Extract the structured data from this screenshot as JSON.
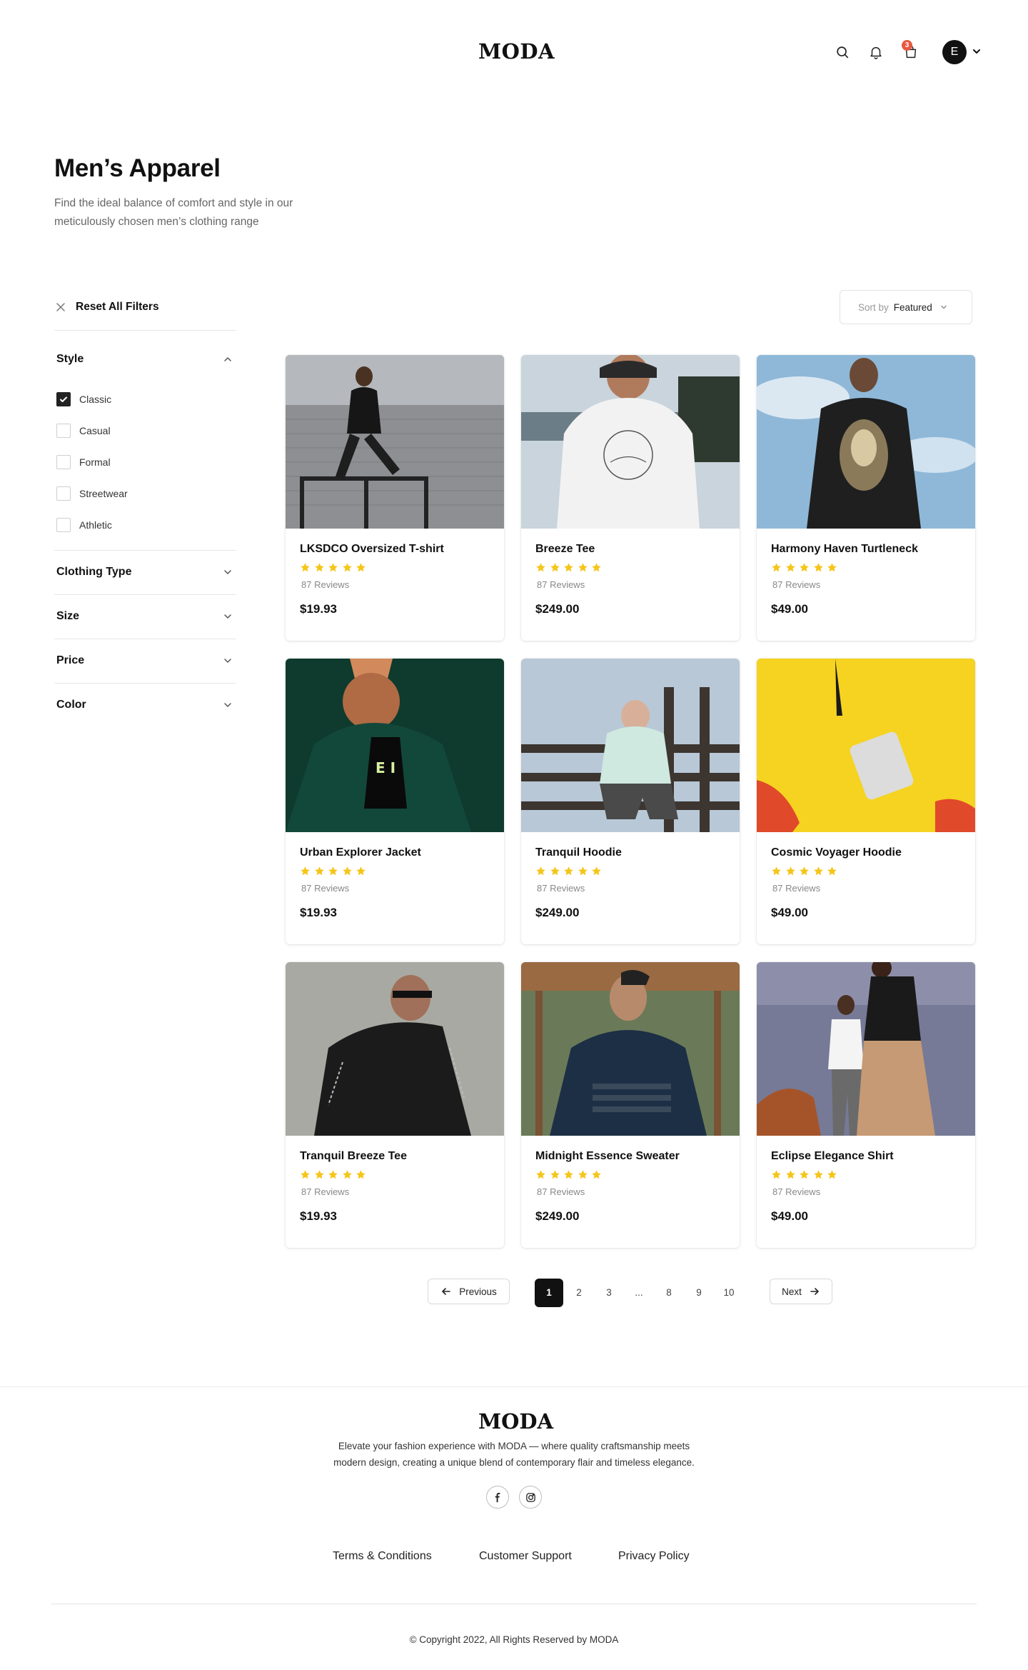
{
  "header": {
    "logo": "MODA",
    "cart_count": "3",
    "avatar_initial": "E"
  },
  "page": {
    "title": "Men’s Apparel",
    "description_line1": "Find the ideal balance of comfort and style in our",
    "description_line2": "meticulously chosen men’s clothing range"
  },
  "filters": {
    "reset_label": "Reset All Filters",
    "style": {
      "label": "Style",
      "options": [
        {
          "label": "Classic",
          "checked": true
        },
        {
          "label": "Casual",
          "checked": false
        },
        {
          "label": "Formal",
          "checked": false
        },
        {
          "label": "Streetwear",
          "checked": false
        },
        {
          "label": "Athletic",
          "checked": false
        }
      ]
    },
    "clothing_type": {
      "label": "Clothing Type"
    },
    "size": {
      "label": "Size"
    },
    "price": {
      "label": "Price"
    },
    "color": {
      "label": "Color"
    }
  },
  "sort": {
    "label": "Sort by",
    "value": "Featured"
  },
  "products": [
    {
      "name": "LKSDCO Oversized T-shirt",
      "rating": 5,
      "reviews": "87 Reviews",
      "price": "$19.93"
    },
    {
      "name": "Breeze Tee",
      "rating": 5,
      "reviews": "87 Reviews",
      "price": "$249.00"
    },
    {
      "name": "Harmony Haven Turtleneck",
      "rating": 5,
      "reviews": "87 Reviews",
      "price": "$49.00"
    },
    {
      "name": "Urban Explorer Jacket",
      "rating": 5,
      "reviews": "87 Reviews",
      "price": "$19.93"
    },
    {
      "name": "Tranquil Hoodie",
      "rating": 5,
      "reviews": "87 Reviews",
      "price": "$249.00"
    },
    {
      "name": "Cosmic Voyager Hoodie",
      "rating": 5,
      "reviews": "87 Reviews",
      "price": "$49.00"
    },
    {
      "name": "Tranquil Breeze Tee",
      "rating": 5,
      "reviews": "87 Reviews",
      "price": "$19.93"
    },
    {
      "name": "Midnight Essence Sweater",
      "rating": 5,
      "reviews": "87 Reviews",
      "price": "$249.00"
    },
    {
      "name": "Eclipse Elegance Shirt",
      "rating": 5,
      "reviews": "87 Reviews",
      "price": "$49.00"
    }
  ],
  "pagination": {
    "previous": "Previous",
    "next": "Next",
    "pages": [
      "1",
      "2",
      "3",
      "...",
      "8",
      "9",
      "10"
    ],
    "current": "1"
  },
  "footer": {
    "logo": "MODA",
    "description_line1": "Elevate your fashion experience with MODA — where quality craftsmanship meets",
    "description_line2": "modern design, creating a unique blend of contemporary flair and timeless elegance.",
    "social": [
      "facebook-icon",
      "instagram-icon"
    ],
    "links": {
      "terms": "Terms & Conditions",
      "support": "Customer Support",
      "privacy": "Privacy Policy"
    },
    "copyright": "© Copyright 2022, All Rights Reserved by MODA"
  },
  "colors": {
    "star": "#f5c518",
    "badge": "#e8573f",
    "primary": "#111111"
  }
}
